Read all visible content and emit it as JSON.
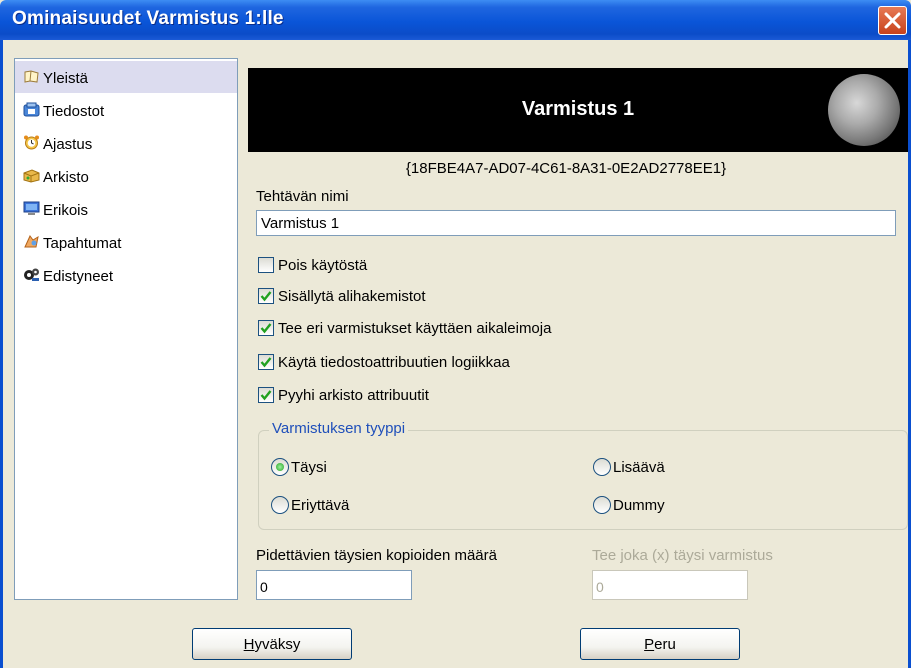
{
  "window": {
    "title": "Ominaisuudet Varmistus 1:lle"
  },
  "sidebar": {
    "items": [
      {
        "label": "Yleistä",
        "icon": "general-icon",
        "selected": true
      },
      {
        "label": "Tiedostot",
        "icon": "files-icon",
        "selected": false
      },
      {
        "label": "Ajastus",
        "icon": "alarm-clock-icon",
        "selected": false
      },
      {
        "label": "Arkisto",
        "icon": "archive-icon",
        "selected": false
      },
      {
        "label": "Erikois",
        "icon": "monitor-icon",
        "selected": false
      },
      {
        "label": "Tapahtumat",
        "icon": "events-icon",
        "selected": false
      },
      {
        "label": "Edistyneet",
        "icon": "advanced-icon",
        "selected": false
      }
    ]
  },
  "header": {
    "title": "Varmistus 1",
    "guid": "{18FBE4A7-AD07-4C61-8A31-0E2AD2778EE1}"
  },
  "form": {
    "name_label": "Tehtävän nimi",
    "name_value": "Varmistus 1",
    "checkboxes": [
      {
        "label": "Pois käytöstä",
        "checked": false
      },
      {
        "label": "Sisällytä alihakemistot",
        "checked": true
      },
      {
        "label": "Tee eri varmistukset käyttäen aikaleimoja",
        "checked": true
      },
      {
        "label": "Käytä tiedostoattribuutien logiikkaa",
        "checked": true
      },
      {
        "label": "Pyyhi arkisto attribuutit",
        "checked": true
      }
    ],
    "backup_type": {
      "legend": "Varmistuksen tyyppi",
      "options": [
        {
          "label": "Täysi",
          "selected": true
        },
        {
          "label": "Lisäävä",
          "selected": false
        },
        {
          "label": "Eriyttävä",
          "selected": false
        },
        {
          "label": "Dummy",
          "selected": false
        }
      ]
    },
    "keep_copies_label": "Pidettävien täysien kopioiden määrä",
    "keep_copies_value": "0",
    "every_x_label": "Tee joka (x) täysi varmistus",
    "every_x_value": "0"
  },
  "buttons": {
    "ok_hotkey": "H",
    "ok_rest": "yväksy",
    "cancel_hotkey": "P",
    "cancel_rest": "eru"
  },
  "colors": {
    "titlebar": "#0a55d8",
    "face": "#ece9d8",
    "accent_text": "#1f4fba",
    "check": "#21a121"
  }
}
